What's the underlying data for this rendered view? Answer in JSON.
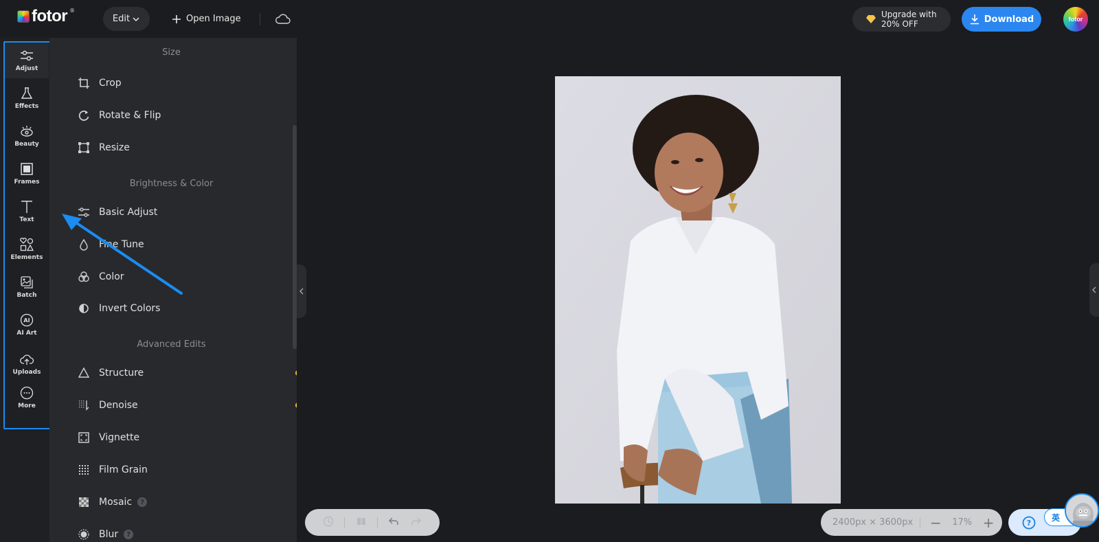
{
  "header": {
    "logo_text": "fotor",
    "logo_reg": "®",
    "edit_label": "Edit",
    "open_image_label": "Open Image",
    "upgrade_line1": "Upgrade with",
    "upgrade_line2": "20% OFF",
    "download_label": "Download",
    "avatar_text": "fotor"
  },
  "nav": {
    "items": [
      {
        "label": "Adjust",
        "icon": "sliders-icon",
        "active": true
      },
      {
        "label": "Effects",
        "icon": "flask-icon"
      },
      {
        "label": "Beauty",
        "icon": "eye-icon"
      },
      {
        "label": "Frames",
        "icon": "frame-icon"
      },
      {
        "label": "Text",
        "icon": "text-icon"
      },
      {
        "label": "Elements",
        "icon": "shapes-icon"
      },
      {
        "label": "Batch",
        "icon": "batch-images-icon"
      },
      {
        "label": "AI Art",
        "icon": "ai-icon"
      },
      {
        "label": "Uploads",
        "icon": "cloud-upload-icon"
      },
      {
        "label": "More",
        "icon": "more-icon"
      }
    ],
    "ai_glyph": "AI"
  },
  "panel": {
    "sections": {
      "size": "Size",
      "brightness": "Brightness & Color",
      "advanced": "Advanced Edits"
    },
    "items": [
      {
        "label": "Crop",
        "icon": "crop-icon"
      },
      {
        "label": "Rotate & Flip",
        "icon": "rotate-icon"
      },
      {
        "label": "Resize",
        "icon": "resize-icon"
      },
      {
        "label": "Basic Adjust",
        "icon": "sliders-icon"
      },
      {
        "label": "Fine Tune",
        "icon": "droplet-icon"
      },
      {
        "label": "Color",
        "icon": "color-circles-icon"
      },
      {
        "label": "Invert Colors",
        "icon": "invert-icon",
        "toggle": false,
        "premium": true
      },
      {
        "label": "Structure",
        "icon": "triangle-icon",
        "premium": true
      },
      {
        "label": "Denoise",
        "icon": "denoise-icon",
        "premium": true
      },
      {
        "label": "Vignette",
        "icon": "vignette-icon"
      },
      {
        "label": "Film Grain",
        "icon": "grain-icon"
      },
      {
        "label": "Mosaic",
        "icon": "mosaic-icon",
        "help": "?"
      },
      {
        "label": "Blur",
        "icon": "blur-icon",
        "help": "?"
      }
    ]
  },
  "canvas": {
    "image_alt": "Smiling woman in white blouse and light blue pants seated on a stool"
  },
  "bottom": {
    "dimensions": "2400px × 3600px",
    "zoom_level": "17%",
    "zoom_out": "−",
    "zoom_in": "+",
    "help_label": "Help",
    "lang_badge": "英"
  },
  "colors": {
    "accent": "#2b86f0",
    "premium_dot": "#f5c242",
    "annotation": "#1a8cf2"
  }
}
